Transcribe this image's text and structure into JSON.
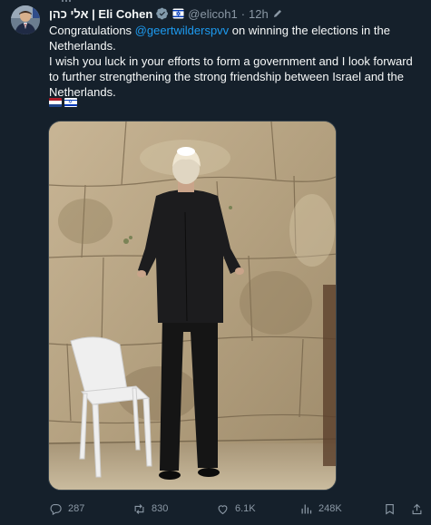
{
  "tweet": {
    "display_name": "אלי כהן | Eli Cohen",
    "handle": "@elicoh1",
    "separator": "·",
    "time": "12h",
    "text_part1": "Congratulations ",
    "mention": "@geertwilderspvv",
    "text_part2": " on winning the elections in the Netherlands.",
    "text_line2": "I wish you luck in your efforts to form a government and I look forward to further strengthening the strong friendship between Israel and the Netherlands.",
    "flags": [
      "netherlands-flag",
      "israel-flag"
    ]
  },
  "actions": {
    "replies": "287",
    "reposts": "830",
    "likes": "6.1K",
    "views": "248K"
  },
  "icons": [
    "verified-badge-icon",
    "affiliate-flag-icon",
    "edit-icon",
    "reply-icon",
    "repost-icon",
    "like-icon",
    "views-icon",
    "bookmark-icon",
    "share-icon"
  ],
  "colors": {
    "background": "#15202b",
    "text": "#f7f9f9",
    "secondary_text": "#8b98a5",
    "link": "#1d9bf0",
    "verified": "#829aab"
  }
}
